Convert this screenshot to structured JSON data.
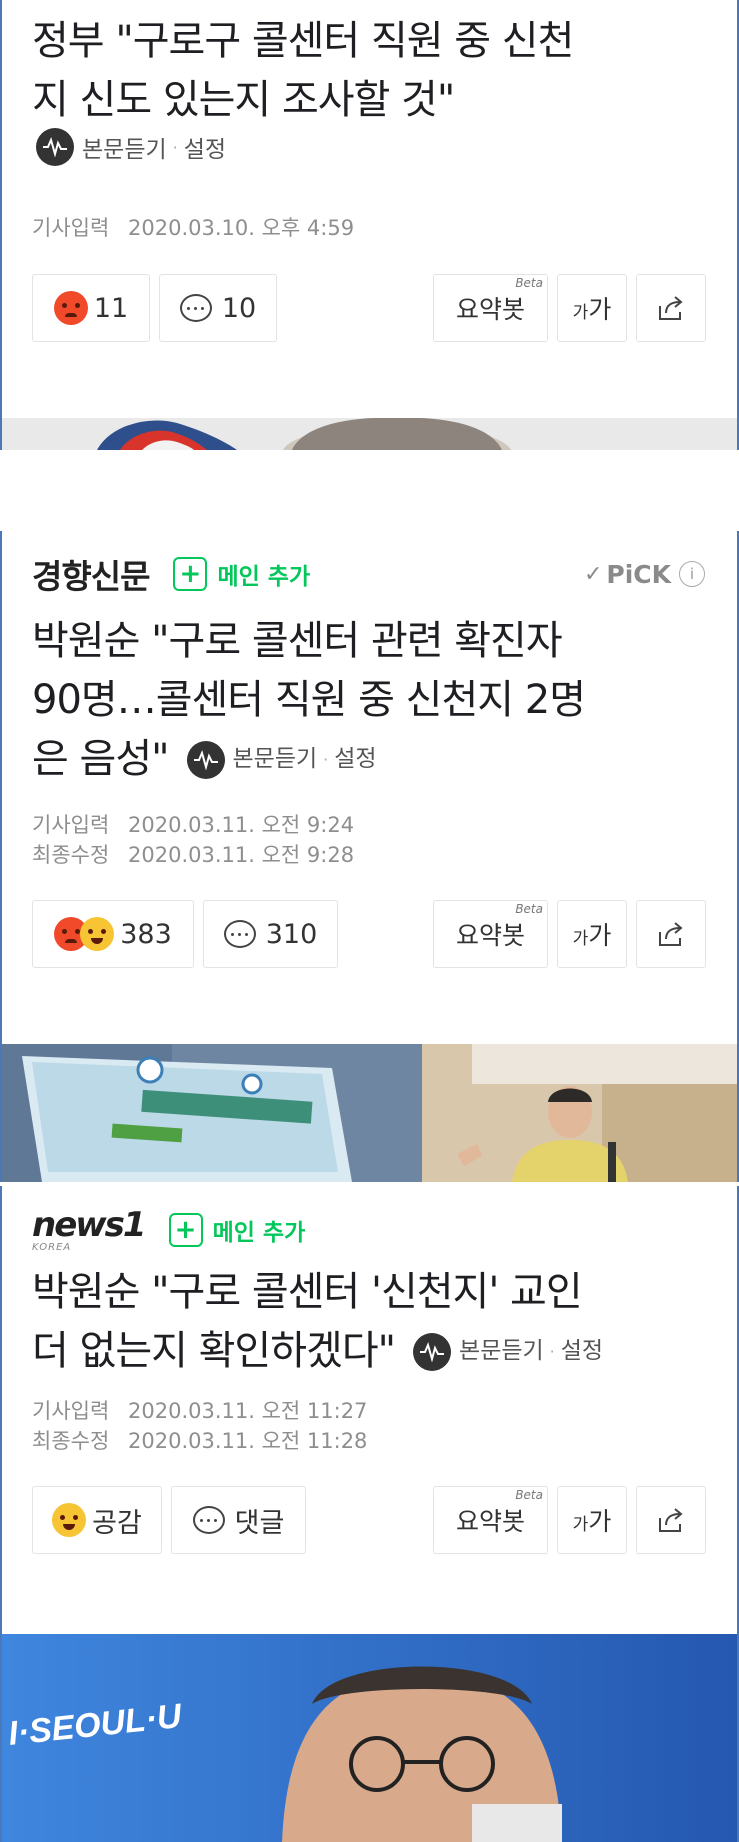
{
  "articles": [
    {
      "headline": "정부 \"구로구 콜센터 직원 중 신천지 신도 있는지 조사할 것\"",
      "headline_lines": [
        "정부 \"구로구 콜센터 직원 중 신천",
        "지 신도 있는지 조사할 것\""
      ],
      "tts_label": "본문듣기",
      "settings_label": "설정",
      "dates": [
        {
          "label": "기사입력",
          "value": "2020.03.10. 오후 4:59"
        }
      ],
      "reaction_count": "11",
      "comment_count": "10"
    },
    {
      "press_name": "경향신문",
      "subscribe_label": "메인 추가",
      "pick_label": "PiCK",
      "headline_lines": [
        "박원순 \"구로 콜센터 관련 확진자",
        "90명…콜센터 직원 중 신천지 2명",
        "은 음성\""
      ],
      "tts_label": "본문듣기",
      "settings_label": "설정",
      "dates": [
        {
          "label": "기사입력",
          "value": "2020.03.11. 오전 9:24"
        },
        {
          "label": "최종수정",
          "value": "2020.03.11. 오전 9:28"
        }
      ],
      "reaction_count": "383",
      "comment_count": "310"
    },
    {
      "press_name": "news1",
      "press_sub": "KOREA",
      "subscribe_label": "메인 추가",
      "headline_lines": [
        "박원순 \"구로 콜센터 '신천지' 교인",
        "더 없는지 확인하겠다\""
      ],
      "tts_label": "본문듣기",
      "settings_label": "설정",
      "dates": [
        {
          "label": "기사입력",
          "value": "2020.03.11. 오전 11:27"
        },
        {
          "label": "최종수정",
          "value": "2020.03.11. 오전 11:28"
        }
      ],
      "reaction_label": "공감",
      "comment_label": "댓글",
      "photo_text": "I·SEOUL·U"
    }
  ],
  "toolbar": {
    "summary_label": "요약봇",
    "summary_beta": "Beta",
    "fontsize_small": "가",
    "fontsize_large": "가"
  },
  "colors": {
    "accent_green": "#03c75a",
    "border_blue": "#4a78b8",
    "angry": "#f04a2a",
    "happy": "#f7c534"
  },
  "icons": [
    "tts-icon",
    "angry-emoji-icon",
    "happy-emoji-icon",
    "comment-icon",
    "share-icon",
    "plus-icon",
    "check-icon",
    "info-icon"
  ]
}
